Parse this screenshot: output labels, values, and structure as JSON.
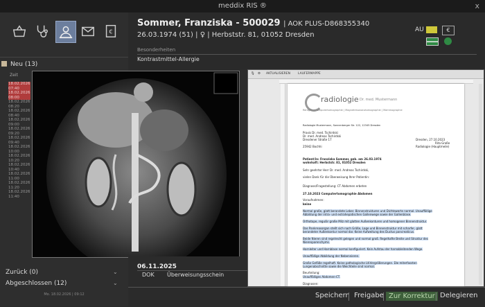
{
  "titlebar": {
    "title": "meddix RIS ®",
    "close": "x"
  },
  "toolbar": {
    "icons": [
      "basket-icon",
      "stethoscope-icon",
      "patient-icon",
      "mail-icon",
      "invoice-icon"
    ],
    "active": 2
  },
  "worklist": {
    "neu_label": "Neu (13)",
    "zeit_label": "Zeit",
    "entries": [
      {
        "date": "18.02.2026",
        "time": "07:40",
        "highlight": true
      },
      {
        "date": "18.02.2026",
        "time": "08:00",
        "highlight": true
      },
      {
        "date": "18.02.2026",
        "time": "08:20",
        "highlight": false
      },
      {
        "date": "18.02.2026",
        "time": "08:40",
        "highlight": false
      },
      {
        "date": "18.02.2026",
        "time": "09:00",
        "highlight": false
      },
      {
        "date": "18.02.2026",
        "time": "09:20",
        "highlight": false
      },
      {
        "date": "18.02.2026",
        "time": "09:40",
        "highlight": false
      },
      {
        "date": "18.02.2026",
        "time": "10:00",
        "highlight": false
      },
      {
        "date": "18.02.2026",
        "time": "10:20",
        "highlight": false
      },
      {
        "date": "18.02.2026",
        "time": "10:40",
        "highlight": false
      },
      {
        "date": "18.02.2026",
        "time": "11:00",
        "highlight": false
      },
      {
        "date": "18.02.2026",
        "time": "11:20",
        "highlight": false
      },
      {
        "date": "18.02.2026",
        "time": "11:40",
        "highlight": false
      }
    ],
    "zurueck_label": "Zurück (0)",
    "abgeschlossen_label": "Abgeschlossen (12)",
    "footer": "Mo. 18.02.2026 | 09:12"
  },
  "patient": {
    "name": "Sommer, Franziska - 500029",
    "insurance": "| AOK PLUS-D868355340",
    "birth_address": "26.03.1974 (51) | ♀ | Herbststr. 81, 01052 Dresden",
    "besonderheiten_label": "Besonderheiten",
    "besonderheiten_value": "Kontrastmittel-Allergie",
    "au_label": "AU",
    "euro_symbol": "€"
  },
  "document": {
    "date": "06.11.2025",
    "type_label": "DOK",
    "type_value": "Überweisungsschein",
    "toolbar_labels": [
      "AKTUALISIEREN",
      "LAUFERMAPPE"
    ]
  },
  "letter": {
    "logo_text": "radiologie",
    "doctor": "Dr. med. Mustermann",
    "subtitle": "Röntgen | Computertomographie | Magnetresonanztomographie | Mammographie",
    "sender_line": "Radiologie Mustermann, Sonnenberger Str. 122, 12345 Dresden",
    "recipient": [
      "Praxis Dr. med. Tschirdski",
      "Dr. med. Andreas Tschirdski",
      "Dresdener Straße 17",
      "25942 Bochhi"
    ],
    "date_right": "Dresden, 27.10.2023",
    "sign_right": [
      "Rita Große",
      "Radiologie (Hauptmeile)"
    ],
    "patient_line": "Patient/in: Franziska Sommer, geb. am 26.03.1974",
    "patient_address": "wohnhaft: Herbststr. 81, 01052 Dresden",
    "salutation": "Sehr geehrter Herr Dr. med. Andreas Tschirdski,",
    "thanks": "vielen Dank für die Überweisung Ihrer Patientin:",
    "question": "Diagnose/Fragestellung: CT Abdomen erbeten",
    "exam": "27.10.2023    Computertomographie Abdomen",
    "vorbefund_label": "Voraufnahmen:",
    "vorbefund_value": "keine",
    "findings": [
      "Normal große, glatt berandete Leber. Binnenstrukturen und Dichtewerte normal. Unauffällige",
      "Abbildung der intra- und extrahepatischen Gallenwege sowie der Gallenblase.",
      "Orthotope, regulär große Milz mit glatten Außenkonturen und homogener Binnenstruktur.",
      "Das Pankreasorgan stellt sich nach Größe, Lage und Binnenstruktur mit scharfer, glatt",
      "berandeter Außenkontur normal dar. Keine Aufweitung des Ductus pancreaticus.",
      "Beide Nieren sind regelrecht gelegen und normal groß. Regelhafte Breite und Struktur des",
      "Nierenparenchyms.",
      "Harnleiter und Harnblase normal konfiguriert. Kein Aufstau der harnableitenden Wege.",
      "Unauffällige Abbildung der Nebennieren.",
      "Große Gefäße regelhaft. Keine pathologische LK-Vergrößerungen. Die miterfassten",
      "Lungenabschnitte sowie die Weichteile sind normal."
    ],
    "beurteilung_label": "Beurteilung:",
    "beurteilung_value": "Unauffälliges Abdomen-CT.",
    "diagnosen_label": "Diagnosen:"
  },
  "actions": {
    "speichern": "Speichern",
    "freigabe": "Freigabe",
    "korrektur": "Zur Korrektur",
    "delegieren": "Delegieren"
  },
  "colors": {
    "accent_active": "#6c7e9d",
    "red_highlight": "#b03c3c",
    "green": "#2f8a44",
    "yellow": "#cfc83a"
  }
}
